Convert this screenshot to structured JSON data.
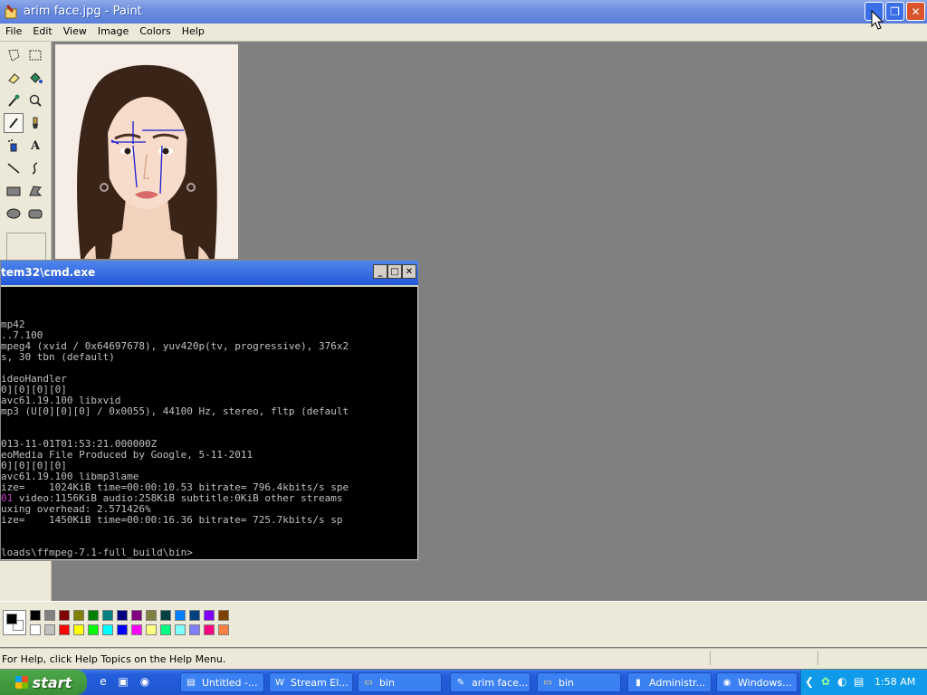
{
  "window": {
    "title": "arim face.jpg - Paint",
    "minimize_icon": "minimize-icon",
    "restore_icon": "restore-icon",
    "close_icon": "close-icon"
  },
  "menu": [
    "File",
    "Edit",
    "View",
    "Image",
    "Colors",
    "Help"
  ],
  "tools": [
    "free-form-select",
    "select",
    "eraser",
    "fill-with-color",
    "pick-color",
    "magnifier",
    "pencil",
    "brush",
    "airbrush",
    "text",
    "line",
    "curve",
    "rectangle",
    "polygon",
    "ellipse",
    "rounded-rectangle"
  ],
  "selected_tool": "pencil",
  "cmd": {
    "title": "tem32\\cmd.exe",
    "lines": [
      "",
      "",
      "",
      "mp42",
      "..7.100",
      "mpeg4 (xvid / 0x64697678), yuv420p(tv, progressive), 376x2",
      "s, 30 tbn (default)",
      "",
      "ideoHandler",
      "0][0][0][0]",
      "avc61.19.100 libxvid",
      "mp3 (U[0][0][0] / 0x0055), 44100 Hz, stereo, fltp (default",
      "",
      "",
      "013-11-01T01:53:21.000000Z",
      "eoMedia File Produced by Google, 5-11-2011",
      "0][0][0][0]",
      "avc61.19.100 libmp3lame",
      "ize=    1024KiB time=00:00:10.53 bitrate= 796.4kbits/s spe",
      "01 video:1156KiB audio:258KiB subtitle:0KiB other streams",
      "uxing overhead: 2.571426%",
      "ize=    1450KiB time=00:00:16.36 bitrate= 725.7kbits/s sp",
      "",
      "",
      "loads\\ffmpeg-7.1-full_build\\bin>"
    ],
    "minimize_icon": "minimize-icon",
    "maximize_icon": "maximize-icon",
    "close_icon": "close-icon"
  },
  "palette": {
    "foreground": "#000000",
    "background": "#ffffff",
    "top_row": [
      "#000000",
      "#808080",
      "#800000",
      "#808000",
      "#008000",
      "#008080",
      "#000080",
      "#800080",
      "#808040",
      "#004040",
      "#0080ff",
      "#004080",
      "#8000ff",
      "#804000"
    ],
    "bottom_row": [
      "#ffffff",
      "#c0c0c0",
      "#ff0000",
      "#ffff00",
      "#00ff00",
      "#00ffff",
      "#0000ff",
      "#ff00ff",
      "#ffff80",
      "#00ff80",
      "#80ffff",
      "#8080ff",
      "#ff0080",
      "#ff8040"
    ]
  },
  "status": {
    "help_text": "For Help, click Help Topics on the Help Menu."
  },
  "taskbar": {
    "start_label": "start",
    "items": [
      {
        "label": "Untitled -...",
        "icon": "notepad-icon"
      },
      {
        "label": "Stream El...",
        "icon": "word-icon"
      },
      {
        "label": "bin",
        "icon": "folder-icon"
      },
      {
        "label": "arim face...",
        "icon": "paint-icon"
      },
      {
        "label": "bin",
        "icon": "folder-icon"
      },
      {
        "label": "Administr...",
        "icon": "cmd-icon"
      },
      {
        "label": "Windows...",
        "icon": "media-player-icon"
      }
    ],
    "clock": "1:58 AM"
  }
}
